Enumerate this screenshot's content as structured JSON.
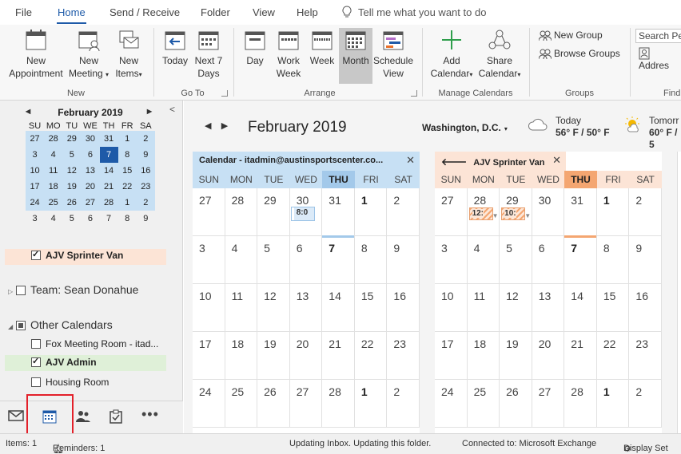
{
  "ribbon_tabs": [
    "File",
    "Home",
    "Send / Receive",
    "Folder",
    "View",
    "Help"
  ],
  "tell_me": "Tell me what you want to do",
  "ribbon": {
    "new_appointment": [
      "New",
      "Appointment"
    ],
    "new_meeting": [
      "New",
      "Meeting"
    ],
    "new_items": [
      "New",
      "Items"
    ],
    "today": "Today",
    "next7": [
      "Next 7",
      "Days"
    ],
    "day": "Day",
    "work_week": [
      "Work",
      "Week"
    ],
    "week": "Week",
    "month": "Month",
    "schedule_view": [
      "Schedule",
      "View"
    ],
    "add_calendar": [
      "Add",
      "Calendar"
    ],
    "share_calendar": [
      "Share",
      "Calendar"
    ],
    "new_group": "New Group",
    "browse_groups": "Browse Groups",
    "search_people": "Search Pe",
    "address_book": "Addres",
    "groups": {
      "new": "New",
      "goto": "Go To",
      "arrange": "Arrange",
      "manage": "Manage Calendars",
      "groups": "Groups",
      "find": "Find"
    }
  },
  "mini_calendar": {
    "title": "February 2019",
    "dow": [
      "SU",
      "MO",
      "TU",
      "WE",
      "TH",
      "FR",
      "SA"
    ],
    "weeks": [
      [
        "27",
        "28",
        "29",
        "30",
        "31",
        "1",
        "2"
      ],
      [
        "3",
        "4",
        "5",
        "6",
        "7",
        "8",
        "9"
      ],
      [
        "10",
        "11",
        "12",
        "13",
        "14",
        "15",
        "16"
      ],
      [
        "17",
        "18",
        "19",
        "20",
        "21",
        "22",
        "23"
      ],
      [
        "24",
        "25",
        "26",
        "27",
        "28",
        "1",
        "2"
      ],
      [
        "3",
        "4",
        "5",
        "6",
        "7",
        "8",
        "9"
      ]
    ],
    "selected_weeks": 5,
    "today": "7"
  },
  "folders": {
    "ajv_sprinter_van": "AJV Sprinter Van",
    "team_sean": "Team: Sean Donahue",
    "other_calendars": "Other Calendars",
    "fox_meeting_room": "Fox Meeting Room - itad...",
    "ajv_admin": "AJV Admin",
    "housing_room": "Housing Room"
  },
  "main": {
    "month_title": "February 2019",
    "location": "Washington, D.C.",
    "weather_today": {
      "label": "Today",
      "temp": "56° F / 50° F"
    },
    "weather_tomorrow": {
      "label": "Tomorr",
      "temp": "60° F / 5"
    },
    "calendars": [
      {
        "tab_label": "Calendar - itadmin@austinsportscenter.co...",
        "color": "#c7e0f4",
        "today_color": "#a3c9ea",
        "accent": "#1e5aa8",
        "appointments": [
          {
            "week": 0,
            "day": 3,
            "text": "8:0"
          }
        ]
      },
      {
        "tab_label": "AJV Sprinter Van",
        "color": "#fce4d6",
        "today_color": "#f4a671",
        "accent": "#e8702a",
        "appointments": [
          {
            "week": 0,
            "day": 1,
            "text": "12:"
          },
          {
            "week": 0,
            "day": 2,
            "text": "10:"
          }
        ]
      }
    ],
    "dow": [
      "SUN",
      "MON",
      "TUE",
      "WED",
      "THU",
      "FRI",
      "SAT"
    ],
    "weeks": [
      [
        "27",
        "28",
        "29",
        "30",
        "31",
        "1",
        "2"
      ],
      [
        "3",
        "4",
        "5",
        "6",
        "7",
        "8",
        "9"
      ],
      [
        "10",
        "11",
        "12",
        "13",
        "14",
        "15",
        "16"
      ],
      [
        "17",
        "18",
        "19",
        "20",
        "21",
        "22",
        "23"
      ],
      [
        "24",
        "25",
        "26",
        "27",
        "28",
        "1",
        "2"
      ]
    ],
    "bold_days": [
      "1",
      "7"
    ]
  },
  "status": {
    "items": "Items: 1",
    "reminders": "Reminders: 1",
    "updating": "Updating Inbox.  Updating this folder.",
    "connected": "Connected to: Microsoft Exchange",
    "display": "Display Set"
  },
  "colors": {
    "accent": "#1e5aa8",
    "nav_highlight": "#e3202a"
  }
}
